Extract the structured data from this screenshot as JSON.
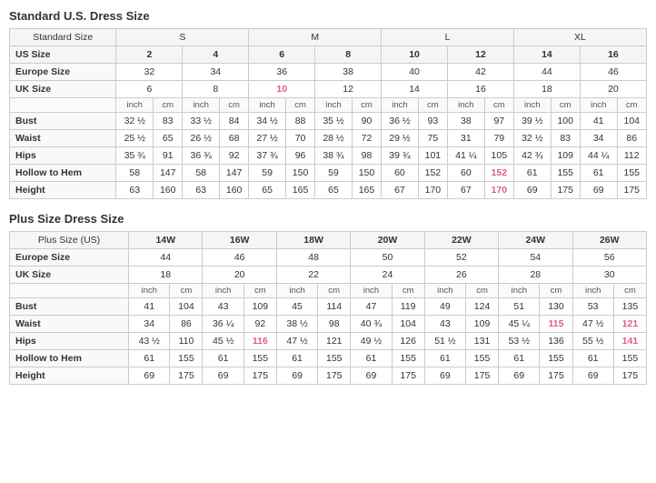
{
  "standard": {
    "title": "Standard U.S. Dress Size",
    "size_groups": [
      "S",
      "M",
      "L",
      "XL"
    ],
    "headers": {
      "standard_size": "Standard Size",
      "us_size": "US Size",
      "europe_size": "Europe Size",
      "uk_size": "UK Size",
      "bust": "Bust",
      "waist": "Waist",
      "hips": "Hips",
      "hollow_to_hem": "Hollow to Hem",
      "height": "Height"
    },
    "us_sizes": [
      "2",
      "4",
      "6",
      "8",
      "10",
      "12",
      "14",
      "16"
    ],
    "europe_sizes": [
      "32",
      "34",
      "36",
      "38",
      "40",
      "42",
      "44",
      "46"
    ],
    "uk_sizes": [
      "6",
      "8",
      "10",
      "12",
      "14",
      "16",
      "18",
      "20"
    ],
    "units": [
      "inch",
      "cm",
      "inch",
      "cm",
      "inch",
      "cm",
      "inch",
      "cm",
      "inch",
      "cm",
      "inch",
      "cm",
      "inch",
      "cm",
      "inch",
      "cm"
    ],
    "bust": [
      "32 ½",
      "83",
      "33 ½",
      "84",
      "34 ½",
      "88",
      "35 ½",
      "90",
      "36 ½",
      "93",
      "38",
      "97",
      "39 ½",
      "100",
      "41",
      "104"
    ],
    "waist": [
      "25 ½",
      "65",
      "26 ½",
      "68",
      "27 ½",
      "70",
      "28 ½",
      "72",
      "29 ½",
      "75",
      "31",
      "79",
      "32 ½",
      "83",
      "34",
      "86"
    ],
    "hips": [
      "35 ¾",
      "91",
      "36 ¾",
      "92",
      "37 ¾",
      "96",
      "38 ¾",
      "98",
      "39 ¾",
      "101",
      "41 ¼",
      "105",
      "42 ¾",
      "109",
      "44 ¼",
      "112"
    ],
    "hollow_to_hem": [
      "58",
      "147",
      "58",
      "147",
      "59",
      "150",
      "59",
      "150",
      "60",
      "152",
      "60",
      "152",
      "61",
      "155",
      "61",
      "155"
    ],
    "height": [
      "63",
      "160",
      "63",
      "160",
      "65",
      "165",
      "65",
      "165",
      "67",
      "170",
      "67",
      "170",
      "69",
      "175",
      "69",
      "175"
    ],
    "pink_uk": [
      2
    ],
    "pink_hollow": [
      11
    ],
    "pink_height": [
      11
    ]
  },
  "plus": {
    "title": "Plus Size Dress Size",
    "headers": {
      "plus_size": "Plus Size (US)",
      "europe_size": "Europe Size",
      "uk_size": "UK Size",
      "bust": "Bust",
      "waist": "Waist",
      "hips": "Hips",
      "hollow_to_hem": "Hollow to Hem",
      "height": "Height"
    },
    "plus_sizes": [
      "14W",
      "16W",
      "18W",
      "20W",
      "22W",
      "24W",
      "26W"
    ],
    "europe_sizes": [
      "44",
      "46",
      "48",
      "50",
      "52",
      "54",
      "56"
    ],
    "uk_sizes": [
      "18",
      "20",
      "22",
      "24",
      "26",
      "28",
      "30"
    ],
    "units": [
      "inch",
      "cm",
      "inch",
      "cm",
      "inch",
      "cm",
      "inch",
      "cm",
      "inch",
      "cm",
      "inch",
      "cm",
      "inch",
      "cm"
    ],
    "bust": [
      "41",
      "104",
      "43",
      "109",
      "45",
      "114",
      "47",
      "119",
      "49",
      "124",
      "51",
      "130",
      "53",
      "135"
    ],
    "waist": [
      "34",
      "86",
      "36 ¼",
      "92",
      "38 ½",
      "98",
      "40 ¾",
      "104",
      "43",
      "109",
      "45 ¼",
      "115",
      "47 ½",
      "121"
    ],
    "hips": [
      "43 ½",
      "110",
      "45 ½",
      "116",
      "47 ½",
      "121",
      "49 ½",
      "126",
      "51 ½",
      "131",
      "53 ½",
      "136",
      "55 ½",
      "141"
    ],
    "hollow_to_hem": [
      "61",
      "155",
      "61",
      "155",
      "61",
      "155",
      "61",
      "155",
      "61",
      "155",
      "61",
      "155",
      "61",
      "155"
    ],
    "height": [
      "69",
      "175",
      "69",
      "175",
      "69",
      "175",
      "69",
      "175",
      "69",
      "175",
      "69",
      "175",
      "69",
      "175"
    ],
    "pink_waist": [
      13
    ],
    "pink_hips": [
      13
    ],
    "pink_plus": [],
    "pink_uk": [
      2
    ]
  }
}
